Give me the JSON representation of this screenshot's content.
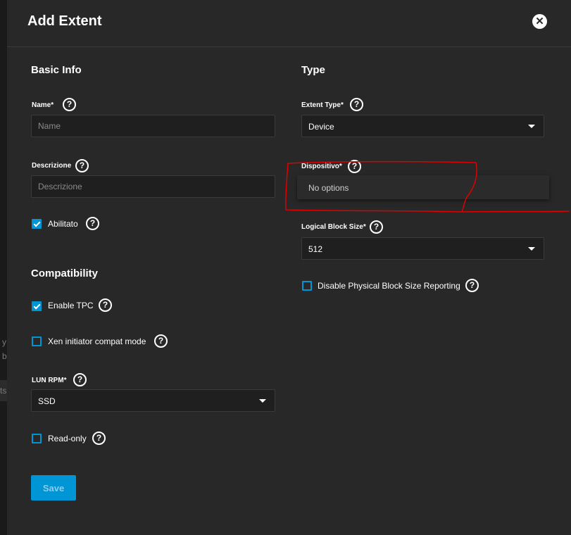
{
  "background_fragments": [
    "y E",
    "b",
    "ts"
  ],
  "dialog": {
    "title": "Add Extent",
    "close_icon": "close-icon"
  },
  "basic_info": {
    "title": "Basic Info",
    "name": {
      "label": "Name",
      "required": "*",
      "placeholder": "Name",
      "value": ""
    },
    "description": {
      "label": "Descrizione",
      "placeholder": "Descrizione",
      "value": ""
    },
    "enabled": {
      "label": "Abilitato",
      "checked": true
    }
  },
  "compatibility": {
    "title": "Compatibility",
    "enable_tpc": {
      "label": "Enable TPC",
      "checked": true
    },
    "xen_compat": {
      "label": "Xen initiator compat mode",
      "checked": false
    },
    "lun_rpm": {
      "label": "LUN RPM",
      "required": "*",
      "value": "SSD"
    },
    "read_only": {
      "label": "Read-only",
      "checked": false
    }
  },
  "type": {
    "title": "Type",
    "extent_type": {
      "label": "Extent Type",
      "required": "*",
      "value": "Device"
    },
    "device": {
      "label": "Dispositivo",
      "required": "*",
      "dropdown_text": "No options"
    },
    "logical_block_size": {
      "label": "Logical Block Size",
      "required": "*",
      "value": "512"
    },
    "disable_physical_block": {
      "label": "Disable Physical Block Size Reporting",
      "checked": false
    }
  },
  "actions": {
    "save_label": "Save"
  },
  "help_glyph": "?",
  "colors": {
    "accent": "#0095d5",
    "panel_bg": "#282828",
    "input_bg": "#1f1f1f",
    "annotation": "#e00000"
  }
}
